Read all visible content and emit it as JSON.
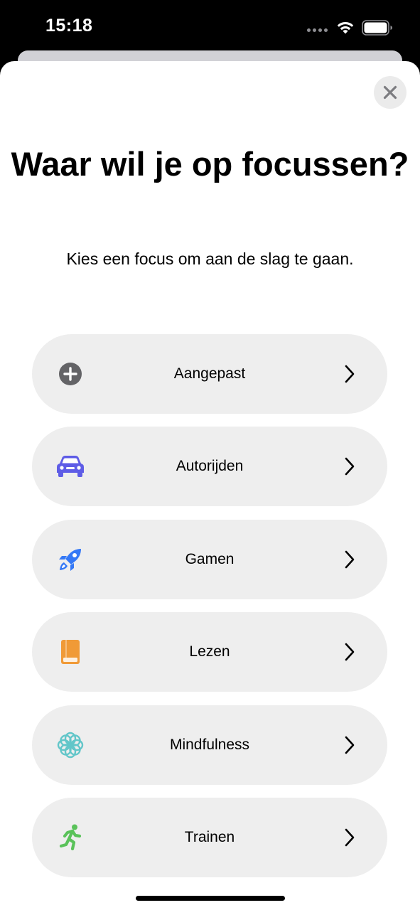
{
  "status_bar": {
    "time": "15:18"
  },
  "header": {
    "title": "Waar wil je op focussen?",
    "subtitle": "Kies een focus om aan de slag te gaan."
  },
  "focus_options": [
    {
      "label": "Aangepast",
      "icon": "plus-circle-icon",
      "color": "#636366"
    },
    {
      "label": "Autorijden",
      "icon": "car-icon",
      "color": "#5e5ce6"
    },
    {
      "label": "Gamen",
      "icon": "rocket-icon",
      "color": "#3478f6"
    },
    {
      "label": "Lezen",
      "icon": "book-icon",
      "color": "#f09a37"
    },
    {
      "label": "Mindfulness",
      "icon": "flower-icon",
      "color": "#62c6c9"
    },
    {
      "label": "Trainen",
      "icon": "running-figure-icon",
      "color": "#5ac25a"
    }
  ]
}
